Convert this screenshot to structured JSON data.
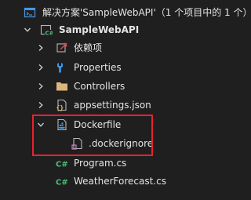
{
  "solution": {
    "label": "解决方案'SampleWebAPI'（1 个项目中的 1 个）"
  },
  "project": {
    "label": "SampleWebAPI"
  },
  "items": {
    "dependencies": "依赖项",
    "properties": "Properties",
    "controllers": "Controllers",
    "appsettings": "appsettings.json",
    "dockerfile": "Dockerfile",
    "dockerignore": ".dockerignore",
    "program": "Program.cs",
    "weatherforecast": "WeatherForecast.cs"
  },
  "colors": {
    "background": "#1f1f1f",
    "text": "#e4e4e4",
    "highlight_border": "#e8222e",
    "csharp_green": "#4ec07a",
    "folder_yellow": "#dcb67a",
    "wrench_blue": "#3b9ae8"
  }
}
